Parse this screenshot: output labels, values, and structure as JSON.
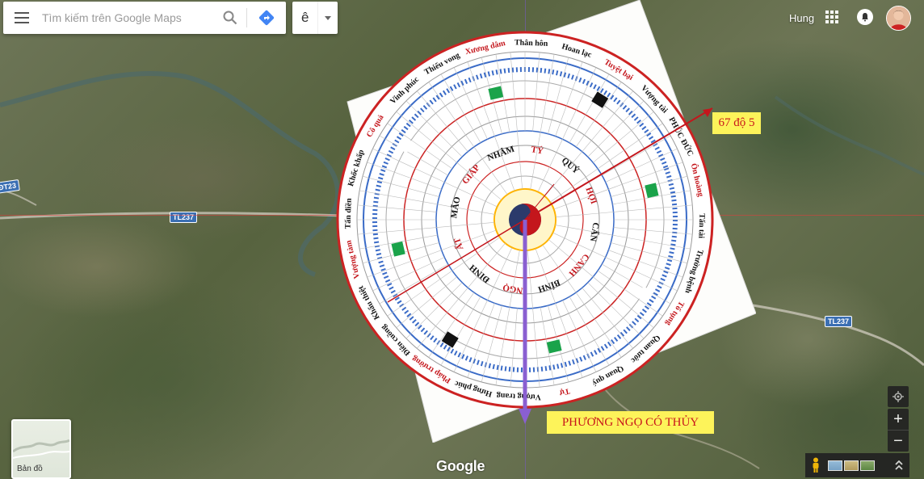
{
  "search": {
    "placeholder": "Tìm kiếm trên Google Maps"
  },
  "ime": {
    "char": "ê"
  },
  "user": {
    "name": "Hung"
  },
  "map": {
    "roads": [
      "TL237",
      "TL237",
      "ĐT23"
    ],
    "annotation_bearing": "67 độ 5",
    "annotation_direction": "PHƯƠNG NGỌ CÓ THỦY"
  },
  "compass": {
    "outer_ring": [
      "Xương dâm",
      "Thân hôn",
      "Hoan lạc",
      "Tuyệt bại",
      "Vượng tài",
      "PHÚC ĐỨC",
      "Ôn hoàng",
      "Tấn tài",
      "Trường bệnh",
      "Tố tụng",
      "Quan tước",
      "Quan quý",
      "Tự",
      "Vượng trang",
      "Hưng phúc",
      "Pháp trường",
      "Điên cuồng",
      "Khẩu thiệt",
      "Vượng tàm",
      "Tấn điền",
      "Khốc khấp",
      "Cô quả",
      "Vinh phúc",
      "Thiếu vong"
    ],
    "center_chars": [
      "NHÂM",
      "TÝ",
      "QUÝ",
      "HỢI",
      "CẤN",
      "CANH",
      "BÍNH",
      "NGỌ",
      "ĐINH",
      "ẤT",
      "MÃO",
      "GIÁP"
    ]
  },
  "layer": {
    "label": "Bản đồ"
  },
  "brand": {
    "logo": "Google"
  },
  "controls": {
    "zoom_in": "+",
    "zoom_out": "−"
  }
}
